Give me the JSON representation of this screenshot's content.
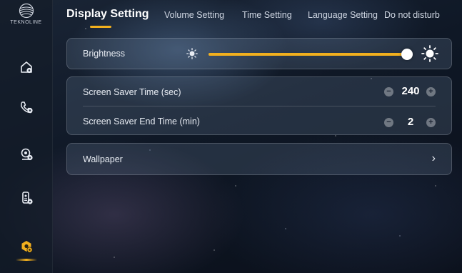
{
  "brand": {
    "name": "TEKNOLINE"
  },
  "colors": {
    "accent": "#f2b01e",
    "card_bg": "#4f5f78"
  },
  "sidebar": {
    "items": [
      {
        "icon": "home-settings-icon",
        "active": false
      },
      {
        "icon": "phone-settings-icon",
        "active": false
      },
      {
        "icon": "camera-settings-icon",
        "active": false
      },
      {
        "icon": "intercom-settings-icon",
        "active": false
      },
      {
        "icon": "system-settings-icon",
        "active": true
      }
    ]
  },
  "tabs": [
    {
      "label": "Display Setting",
      "active": true
    },
    {
      "label": "Volume Setting",
      "active": false
    },
    {
      "label": "Time Setting",
      "active": false
    },
    {
      "label": "Language Setting",
      "active": false
    },
    {
      "label": "Do not disturb",
      "active": false
    }
  ],
  "brightness": {
    "label": "Brightness",
    "level": 1.0
  },
  "screen_saver": {
    "time_label": "Screen Saver Time (sec)",
    "time_value": "240",
    "end_label": "Screen Saver End Time (min)",
    "end_value": "2",
    "minus": "−",
    "plus": "+"
  },
  "wallpaper": {
    "label": "Wallpaper",
    "chevron": "›"
  }
}
